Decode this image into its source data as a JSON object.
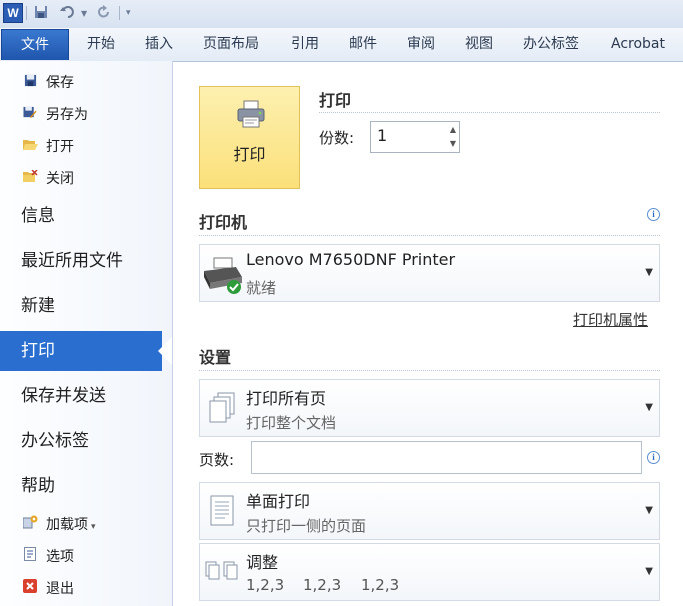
{
  "quick_access": {
    "app_logo": "W",
    "icons": [
      "save-icon",
      "undo-icon",
      "undo-dropdown-icon",
      "redo-icon",
      "customize-icon"
    ]
  },
  "ribbon": {
    "file_tab": "文件",
    "tabs": [
      "开始",
      "插入",
      "页面布局",
      "引用",
      "邮件",
      "审阅",
      "视图",
      "办公标签",
      "Acrobat"
    ]
  },
  "nav": {
    "commands": [
      "保存",
      "另存为",
      "打开",
      "关闭"
    ],
    "items": [
      "信息",
      "最近所用文件",
      "新建",
      "打印",
      "保存并发送",
      "办公标签",
      "帮助"
    ],
    "bottom_commands": [
      "加载项",
      "选项",
      "退出"
    ],
    "selected": "打印"
  },
  "print": {
    "button_label": "打印",
    "section_title": "打印",
    "copies_label": "份数:",
    "copies_value": "1"
  },
  "printer": {
    "section_title": "打印机",
    "name": "Lenovo M7650DNF Printer",
    "status": "就绪",
    "properties_link": "打印机属性"
  },
  "settings": {
    "section_title": "设置",
    "range_title": "打印所有页",
    "range_sub": "打印整个文档",
    "pages_label": "页数:",
    "pages_value": "",
    "sides_title": "单面打印",
    "sides_sub": "只打印一侧的页面",
    "collate_title": "调整",
    "collate_values": [
      "1,2,3",
      "1,2,3",
      "1,2,3"
    ]
  },
  "colors": {
    "accent": "#2a6fd0",
    "print_button": "#fbe07a"
  }
}
